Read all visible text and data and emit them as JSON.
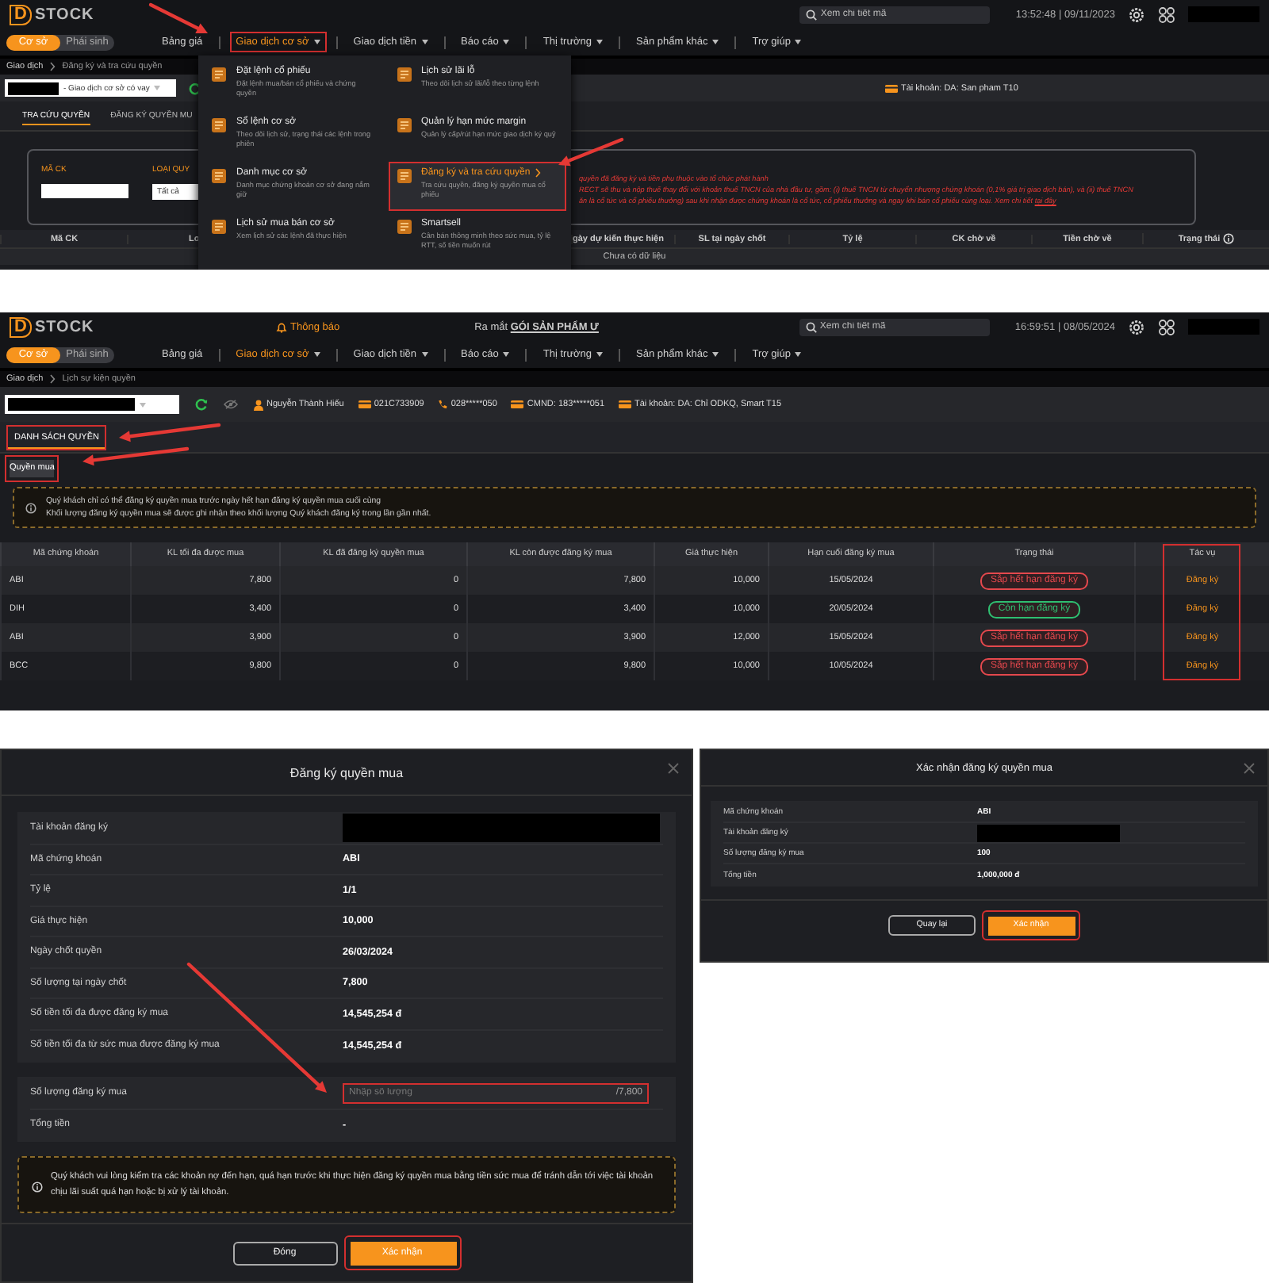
{
  "screen_1": {
    "header": {
      "logo": {
        "mark": "D",
        "name": "STOCK"
      },
      "search": {
        "placeholder": "Xem chi tiết mã"
      },
      "clock": "13:52:48 | 09/11/2023"
    },
    "market_toggle": [
      {
        "label": "Cơ sở",
        "selected": true
      },
      {
        "label": "Phái sinh",
        "selected": false
      }
    ],
    "nav": [
      {
        "label": "Bảng giá",
        "dropdown": false,
        "selected": false,
        "highlighted": false
      },
      {
        "label": "Giao dịch cơ sở",
        "dropdown": true,
        "selected": true,
        "highlighted": true
      },
      {
        "label": "Giao dịch tiền",
        "dropdown": true,
        "selected": false,
        "highlighted": false
      },
      {
        "label": "Báo cáo",
        "dropdown": true,
        "selected": false,
        "highlighted": false
      },
      {
        "label": "Thị trường",
        "dropdown": true,
        "selected": false,
        "highlighted": false
      },
      {
        "label": "Sản phẩm khác",
        "dropdown": true,
        "selected": false,
        "highlighted": false
      },
      {
        "label": "Trợ giúp",
        "dropdown": true,
        "selected": false,
        "highlighted": false
      }
    ],
    "breadcrumb": [
      "Giao dịch",
      "Đăng ký và tra cứu quyền"
    ],
    "account_select": {
      "value": "- Giao dịch cơ sở có vay"
    },
    "account_info": [
      {
        "kind": "account",
        "text": "Tài khoản: DA: San pham T10"
      }
    ],
    "tabs": [
      {
        "label": "TRA CỨU QUYỀN",
        "selected": true,
        "highlighted": false
      },
      {
        "label": "ĐĂNG KÝ QUYỀN MU",
        "selected": false,
        "highlighted": false
      }
    ],
    "filters": [
      {
        "label": "MÃ CK",
        "kind": "input"
      },
      {
        "label": "LOẠI QUY",
        "kind": "select",
        "value": "Tất cả"
      }
    ],
    "notes": [
      {
        "text": "quyền đã đăng ký và tiền phụ thuộc vào tổ chức phát hành"
      },
      {
        "text": "RECT sẽ thu và nộp thuế thay đổi với khoản thuế TNCN của nhà đầu tư, gồm: (i) thuế TNCN từ chuyển nhượng chứng khoán (0,1% giá trị giao dịch bán), và (ii) thuế TNCN"
      },
      {
        "text": "ăn là cổ tức và cổ phiếu thưởng) sau khi nhận được chứng khoán là cổ tức, cổ phiếu thưởng và ngay khi bán cổ phiếu cùng loại. Xem chi tiết ",
        "link": "tại đây"
      }
    ],
    "table": {
      "columns": [
        {
          "label": "Mã CK",
          "info_icon": false
        },
        {
          "label": "Lo",
          "info_icon": false
        },
        {
          "label": "gày dự kiến thực hiện",
          "info_icon": false
        },
        {
          "label": "SL tại ngày chốt",
          "info_icon": false
        },
        {
          "label": "Tỷ lệ",
          "info_icon": false
        },
        {
          "label": "CK chờ về",
          "info_icon": false
        },
        {
          "label": "Tiền chờ về",
          "info_icon": false
        },
        {
          "label": "Trạng thái",
          "info_icon": true
        }
      ],
      "empty_text": "Chưa có dữ liệu"
    },
    "menu": {
      "columns": [
        [
          {
            "title": "Đặt lệnh cổ phiếu",
            "description": "Đặt lệnh mua/bán cổ phiếu và chứng quyền",
            "selected": false,
            "highlighted": false
          },
          {
            "title": "Sổ lệnh cơ sở",
            "description": "Theo dõi lịch sử, trạng thái các lệnh trong phiên",
            "selected": false,
            "highlighted": false
          },
          {
            "title": "Danh mục cơ sở",
            "description": "Danh mục chứng khoán cơ sở đang nắm giữ",
            "selected": false,
            "highlighted": false
          },
          {
            "title": "Lịch sử mua bán cơ sở",
            "description": "Xem lịch sử các lệnh đã thực hiện",
            "selected": false,
            "highlighted": false
          }
        ],
        [
          {
            "title": "Lịch sử lãi lỗ",
            "description": "Theo dõi lịch sử lãi/lỗ theo từng lệnh",
            "selected": false,
            "highlighted": false
          },
          {
            "title": "Quản lý hạn mức margin",
            "description": "Quản lý cấp/rút hạn mức giao dịch ký quỹ",
            "selected": false,
            "highlighted": false
          },
          {
            "title": "Đăng ký và tra cứu quyền",
            "description": "Tra cứu quyền, đăng ký quyền mua cổ phiếu",
            "selected": true,
            "highlighted": true
          },
          {
            "title": "Smartsell",
            "description": "Cân bán thông minh theo sức mua, tỷ lệ RTT, số tiền muốn rút",
            "selected": false,
            "highlighted": false
          }
        ]
      ]
    }
  },
  "screen_2": {
    "header": {
      "logo": {
        "mark": "D",
        "name": "STOCK"
      },
      "notice": "Thông báo",
      "promo": "Ra mắt **GÓI SẢN PHẨM Ư**",
      "search": {
        "placeholder": "Xem chi tiết mã"
      },
      "clock": "16:59:51 | 08/05/2024"
    },
    "market_toggle": [
      {
        "label": "Cơ sở",
        "selected": true
      },
      {
        "label": "Phái sinh",
        "selected": false
      }
    ],
    "nav": [
      {
        "label": "Bảng giá",
        "dropdown": false,
        "selected": false,
        "highlighted": false
      },
      {
        "label": "Giao dịch cơ sở",
        "dropdown": true,
        "selected": true,
        "highlighted": false
      },
      {
        "label": "Giao dịch tiền",
        "dropdown": true,
        "selected": false,
        "highlighted": false
      },
      {
        "label": "Báo cáo",
        "dropdown": true,
        "selected": false,
        "highlighted": false
      },
      {
        "label": "Thị trường",
        "dropdown": true,
        "selected": false,
        "highlighted": false
      },
      {
        "label": "Sản phẩm khác",
        "dropdown": true,
        "selected": false,
        "highlighted": false
      },
      {
        "label": "Trợ giúp",
        "dropdown": true,
        "selected": false,
        "highlighted": false
      }
    ],
    "breadcrumb": [
      "Giao dịch",
      "Lịch sự kiện quyền"
    ],
    "account_info": [
      {
        "kind": "user",
        "text": "Nguyễn Thành Hiếu"
      },
      {
        "kind": "card",
        "text": "021C733909"
      },
      {
        "kind": "phone",
        "text": "028*****050"
      },
      {
        "kind": "card",
        "text": "CMND: 183*****051"
      },
      {
        "kind": "account",
        "text": "Tài khoản: DA: Chỉ ODKQ, Smart T15"
      }
    ],
    "tabs": [
      {
        "label": "DANH SÁCH QUYỀN",
        "selected": true,
        "highlighted": true
      }
    ],
    "subtabs": [
      {
        "label": "Quyền mua",
        "selected": true,
        "highlighted": true
      }
    ],
    "notice": [
      "Quý khách chỉ có thể đăng ký quyền mua trước ngày hết hạn đăng ký quyền mua cuối cùng",
      "Khối lượng đăng ký quyền mua sẽ được ghi nhận theo khối lượng Quý khách đăng ký trong lần gần nhất."
    ],
    "table": {
      "columns": [
        {
          "label": "Mã chứng khoán",
          "highlighted": false
        },
        {
          "label": "KL tối đa được mua",
          "highlighted": false
        },
        {
          "label": "KL đã đăng ký quyền mua",
          "highlighted": false
        },
        {
          "label": "KL còn được đăng ký mua",
          "highlighted": false
        },
        {
          "label": "Giá thực hiện",
          "highlighted": false
        },
        {
          "label": "Hạn cuối đăng ký mua",
          "highlighted": false
        },
        {
          "label": "Trạng thái",
          "highlighted": false
        },
        {
          "label": "Tác vụ",
          "highlighted": true
        }
      ],
      "rows": [
        {
          "code": "ABI",
          "max": "7,800",
          "registered": "0",
          "remaining": "7,800",
          "price": "10,000",
          "deadline": "15/05/2024",
          "status": {
            "text": "Sắp hết hạn đăng ký",
            "color": "#e5484d"
          },
          "action": "Đăng ký"
        },
        {
          "code": "DIH",
          "max": "3,400",
          "registered": "0",
          "remaining": "3,400",
          "price": "10,000",
          "deadline": "20/05/2024",
          "status": {
            "text": "Còn hạn đăng ký",
            "color": "#2fbf71"
          },
          "action": "Đăng ký"
        },
        {
          "code": "ABI",
          "max": "3,900",
          "registered": "0",
          "remaining": "3,900",
          "price": "12,000",
          "deadline": "15/05/2024",
          "status": {
            "text": "Sắp hết hạn đăng ký",
            "color": "#e5484d"
          },
          "action": "Đăng ký"
        },
        {
          "code": "BCC",
          "max": "9,800",
          "registered": "0",
          "remaining": "9,800",
          "price": "10,000",
          "deadline": "10/05/2024",
          "status": {
            "text": "Sắp hết hạn đăng ký",
            "color": "#e5484d"
          },
          "action": "Đăng ký"
        }
      ]
    }
  },
  "dialogs": [
    {
      "title": "Đăng ký quyền mua",
      "blocks": [
        [
          {
            "kind": "text",
            "label": "Tài khoản đăng ký",
            "redacted": true
          },
          {
            "kind": "text",
            "label": "Mã chứng khoán",
            "value": "ABI"
          },
          {
            "kind": "text",
            "label": "Tỷ lệ",
            "value": "1/1"
          },
          {
            "kind": "text",
            "label": "Giá thực hiện",
            "value": "10,000"
          },
          {
            "kind": "text",
            "label": "Ngày chốt quyền",
            "value": "26/03/2024"
          },
          {
            "kind": "text",
            "label": "Số lượng tại ngày chốt",
            "value": "7,800"
          },
          {
            "kind": "text",
            "label": "Số tiền tối đa được đăng ký mua",
            "value": "14,545,254 đ"
          },
          {
            "kind": "text",
            "label": "Số tiền tối đa từ sức mua được đăng ký mua",
            "value": "14,545,254 đ"
          }
        ],
        [
          {
            "kind": "input",
            "label": "Số lượng đăng ký mua",
            "placeholder": "Nhập số lượng",
            "suffix": "/7,800",
            "highlighted": true
          },
          {
            "kind": "text",
            "label": "Tổng tiền",
            "value": "-"
          }
        ]
      ],
      "notice": "Quý khách vui lòng kiểm tra các khoản nợ đến hạn, quá hạn trước khi thực hiện đăng ký quyền mua bằng tiền sức mua để tránh dẫn tới việc tài khoản chịu lãi suất quá hạn hoặc bị xử lý tài khoản.",
      "buttons": [
        {
          "label": "Đóng",
          "kind": "secondary",
          "highlighted": false
        },
        {
          "label": "Xác nhận",
          "kind": "primary",
          "highlighted": true
        }
      ]
    },
    {
      "title": "Xác nhận đăng ký quyền mua",
      "blocks": [
        [
          {
            "kind": "text",
            "label": "Mã chứng khoán",
            "value": "ABI"
          },
          {
            "kind": "text",
            "label": "Tài khoản đăng ký",
            "redacted": true
          },
          {
            "kind": "text",
            "label": "Số lượng đăng ký mua",
            "value": "100"
          },
          {
            "kind": "text",
            "label": "Tổng tiền",
            "value": "1,000,000 đ"
          }
        ]
      ],
      "buttons": [
        {
          "label": "Quay lại",
          "kind": "secondary",
          "highlighted": false
        },
        {
          "label": "Xác nhận",
          "kind": "primary",
          "highlighted": true
        }
      ]
    }
  ]
}
